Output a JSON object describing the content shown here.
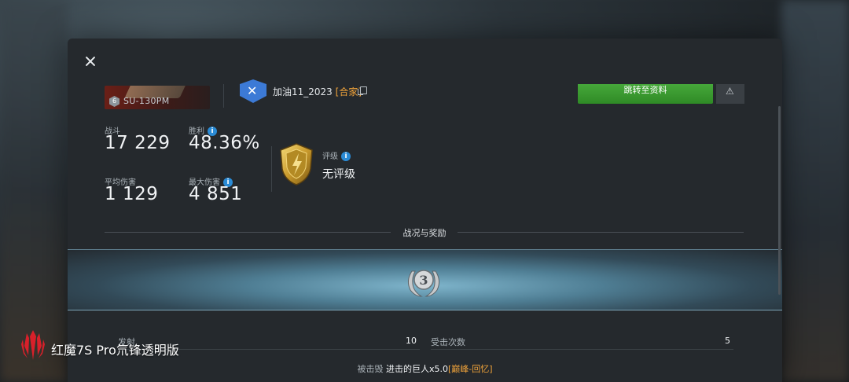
{
  "header": {
    "close_icon": "close-icon",
    "vehicle": {
      "tier": "6",
      "name": "SU-130PM"
    },
    "player": {
      "name": "加油11_2023",
      "tag": "[合家]"
    },
    "profile_button": "跳转至资料",
    "report_icon": "warning-icon"
  },
  "stats": {
    "battles": {
      "label": "战斗",
      "value": "17 229"
    },
    "wins": {
      "label": "胜利",
      "value": "48.36%"
    },
    "avg_damage": {
      "label": "平均伤害",
      "value": "1 129"
    },
    "max_damage": {
      "label": "最大伤害",
      "value": "4 851"
    },
    "rating": {
      "label": "评级",
      "value": "无评级"
    },
    "info_glyph": "i"
  },
  "section": {
    "title": "战况与奖励"
  },
  "medal": {
    "rank": "3",
    "icon": "mastery-badge-icon"
  },
  "battle_stats": [
    {
      "label": "发射",
      "value": "10"
    },
    {
      "label": "受击次数",
      "value": "5"
    }
  ],
  "destroyed_by": {
    "prefix": "被击毁",
    "name": "进击的巨人x5.0",
    "tag": "[巅峰-回忆]"
  },
  "watermark": {
    "text": "红魔7S Pro氘锋透明版"
  },
  "colors": {
    "accent_green": "#3a9b2f",
    "tag_orange": "#f0a33a",
    "info_blue": "#2a8bd6"
  }
}
